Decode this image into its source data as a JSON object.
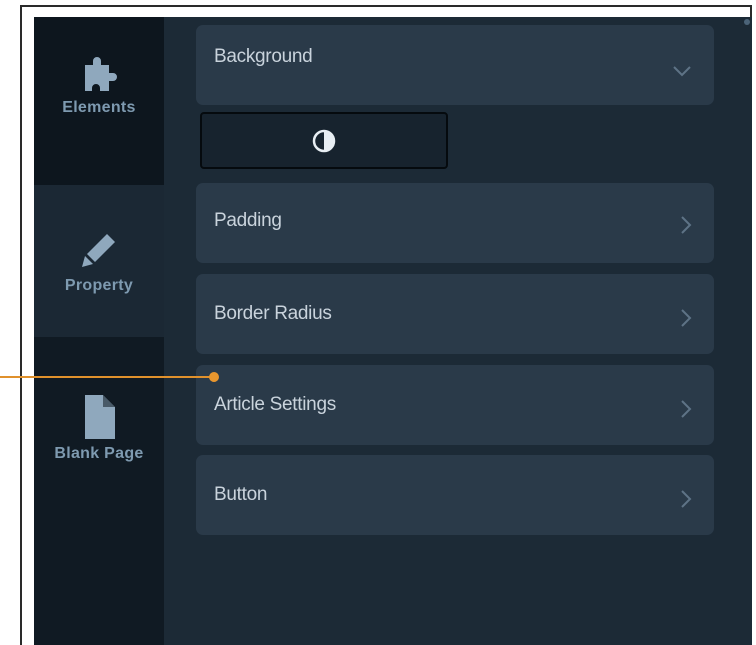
{
  "sidebar": {
    "items": [
      {
        "label": "Elements",
        "icon": "puzzle-icon"
      },
      {
        "label": "Property",
        "icon": "pencil-icon"
      },
      {
        "label": "Blank Page",
        "icon": "document-icon"
      }
    ],
    "active": "Property"
  },
  "panels": {
    "background": {
      "title": "Background",
      "chevron": "chevron-down-icon"
    },
    "contrast_button": {
      "icon": "contrast-icon"
    },
    "padding": {
      "title": "Padding",
      "chevron": "chevron-right-icon"
    },
    "border_radius": {
      "title": "Border Radius",
      "chevron": "chevron-right-icon"
    },
    "article_settings": {
      "title": "Article Settings",
      "chevron": "chevron-right-icon"
    },
    "button": {
      "title": "Button",
      "chevron": "chevron-right-icon"
    }
  },
  "colors": {
    "app_bg": "#1c2a36",
    "sidebar_bg": "#101a23",
    "panel_bg": "#2a3a49",
    "panel_text": "#c9d3dc",
    "sidebar_text": "#7e9ab0",
    "annotation": "#e0912c"
  }
}
